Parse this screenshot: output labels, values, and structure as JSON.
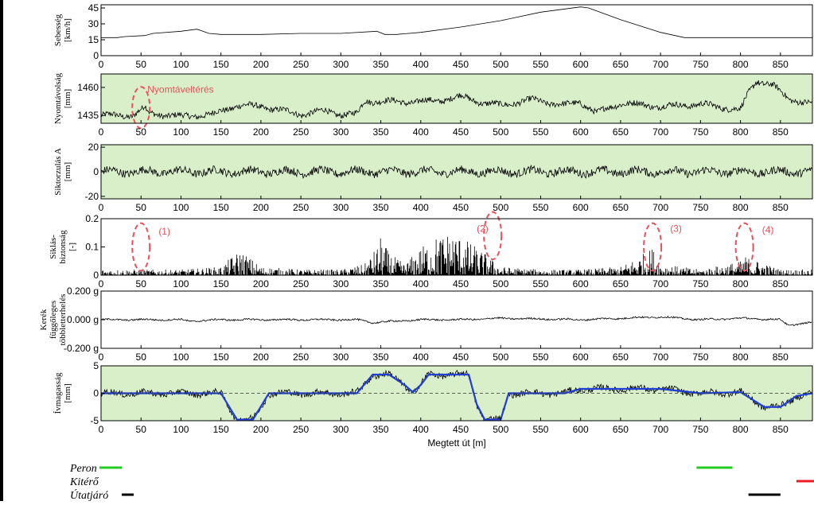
{
  "colors": {
    "panel_green": "#d9efc9",
    "trace": "#000000",
    "fit": "#1f3fd6",
    "annotation": "#e8505b",
    "peron": "#22cc22",
    "kitero": "#ee1c24",
    "utatjaro": "#000000"
  },
  "chart_data": {
    "type": "line",
    "xlabel": "Megtett út [m]",
    "xlim": [
      0,
      890
    ],
    "xticks": [
      0,
      50,
      100,
      150,
      200,
      250,
      300,
      350,
      400,
      450,
      500,
      550,
      600,
      650,
      700,
      750,
      800,
      850
    ],
    "panels": [
      {
        "id": "speed",
        "ylabel_lines": [
          "Sebesség",
          "[km/h]"
        ],
        "ylim": [
          0,
          48
        ],
        "yticks": [
          0,
          15,
          30,
          45
        ],
        "ytick_labels": [
          "0",
          "15",
          "30",
          "45"
        ],
        "background": "white",
        "trace": "smooth",
        "series": [
          {
            "x": [
              0,
              20,
              30,
              55,
              65,
              100,
              120,
              135,
              150,
              200,
              250,
              300,
              345,
              355,
              370,
              400,
              450,
              500,
              550,
              600,
              610,
              650,
              700,
              730,
              750,
              800,
              850,
              890
            ],
            "y": [
              17,
              17,
              18,
              19,
              21,
              23,
              25,
              21,
              20,
              20,
              21,
              21,
              23,
              20,
              20,
              22,
              27,
              33,
              41,
              46,
              45,
              34,
              22,
              17,
              17,
              17,
              17,
              17
            ]
          }
        ]
      },
      {
        "id": "gauge",
        "ylabel_lines": [
          "Nyomtávolság",
          "[mm]"
        ],
        "ylim": [
          1428,
          1472
        ],
        "yticks": [
          1435,
          1460
        ],
        "ytick_labels": [
          "1435",
          "1460"
        ],
        "background": "green",
        "trace": "noisy",
        "series": [
          {
            "x": [
              0,
              40,
              55,
              60,
              100,
              140,
              170,
              200,
              250,
              280,
              300,
              320,
              330,
              380,
              420,
              450,
              480,
              500,
              540,
              580,
              600,
              620,
              650,
              700,
              750,
              780,
              800,
              810,
              820,
              840,
              860,
              890
            ],
            "y": [
              1435,
              1435,
              1442,
              1437,
              1434,
              1436,
              1444,
              1443,
              1436,
              1439,
              1436,
              1436,
              1448,
              1447,
              1448,
              1452,
              1446,
              1444,
              1449,
              1444,
              1447,
              1437,
              1446,
              1443,
              1445,
              1442,
              1440,
              1455,
              1466,
              1462,
              1450,
              1445
            ]
          }
        ],
        "annotations": [
          {
            "type": "ellipse",
            "x": 50,
            "y": 1442
          },
          {
            "type": "text",
            "x": 58,
            "y": 1458,
            "text": "Nyomtáveltérés"
          }
        ]
      },
      {
        "id": "twist",
        "ylabel_lines": [
          "Siktorzulás A",
          "[mm]"
        ],
        "ylim": [
          -22,
          22
        ],
        "yticks": [
          -20,
          0,
          20
        ],
        "ytick_labels": [
          "-20",
          "0",
          "20"
        ],
        "background": "green",
        "trace": "noisy",
        "series": [
          {
            "x": [
              0,
              100,
              200,
              300,
              400,
              500,
              600,
              690,
              700,
              710,
              800,
              890
            ],
            "y": [
              0,
              0,
              0,
              0,
              0,
              0,
              0,
              0,
              0,
              0,
              0,
              0
            ]
          }
        ]
      },
      {
        "id": "safety",
        "ylabel_lines": [
          "Siklás-",
          "biztonság",
          "[-]"
        ],
        "ylim": [
          0,
          0.2
        ],
        "yticks": [
          0,
          0.1,
          0.2
        ],
        "ytick_labels": [
          "0",
          "0.1",
          "0.2"
        ],
        "background": "white",
        "trace": "spiky",
        "series": [
          {
            "x": [
              0,
              50,
              100,
              150,
              165,
              175,
              200,
              250,
              300,
              330,
              345,
              350,
              360,
              380,
              400,
              420,
              440,
              460,
              480,
              500,
              550,
              600,
              650,
              680,
              690,
              700,
              750,
              800,
              805,
              850,
              890
            ],
            "y": [
              0.02,
              0.02,
              0.02,
              0.03,
              0.07,
              0.09,
              0.03,
              0.02,
              0.02,
              0.04,
              0.1,
              0.14,
              0.08,
              0.04,
              0.1,
              0.14,
              0.16,
              0.12,
              0.08,
              0.03,
              0.02,
              0.02,
              0.03,
              0.08,
              0.1,
              0.04,
              0.02,
              0.05,
              0.07,
              0.02,
              0.02
            ]
          }
        ],
        "annotations": [
          {
            "type": "ellipse",
            "x": 50,
            "y": 0.1
          },
          {
            "type": "text",
            "x": 72,
            "y": 0.155,
            "text": "(1)"
          },
          {
            "type": "ellipse",
            "x": 490,
            "y": 0.14
          },
          {
            "type": "text",
            "x": 470,
            "y": 0.165,
            "text": "(2)"
          },
          {
            "type": "ellipse",
            "x": 690,
            "y": 0.1
          },
          {
            "type": "text",
            "x": 712,
            "y": 0.165,
            "text": "(3)"
          },
          {
            "type": "ellipse",
            "x": 805,
            "y": 0.1
          },
          {
            "type": "text",
            "x": 827,
            "y": 0.16,
            "text": "(4)"
          }
        ]
      },
      {
        "id": "load",
        "ylabel_lines": [
          "Kerék",
          "függőleges",
          "többletterhelés"
        ],
        "ylim": [
          -0.2,
          0.2
        ],
        "yticks": [
          -0.2,
          0,
          0.2
        ],
        "ytick_labels": [
          "-0.200 g",
          "0.000 g",
          "0.200 g"
        ],
        "background": "white",
        "trace": "mild",
        "series": [
          {
            "x": [
              0,
              50,
              100,
              110,
              150,
              200,
              300,
              320,
              340,
              400,
              450,
              500,
              600,
              700,
              750,
              800,
              850,
              860,
              870,
              890
            ],
            "y": [
              0,
              0,
              0,
              -0.01,
              0,
              0,
              0,
              0,
              -0.02,
              0,
              0,
              0.01,
              0,
              0.02,
              0,
              0.01,
              0,
              -0.04,
              -0.03,
              -0.02
            ]
          }
        ]
      },
      {
        "id": "cant",
        "ylabel_lines": [
          "Ívmagasság",
          "[mm]"
        ],
        "ylim": [
          -5,
          5
        ],
        "yticks": [
          -5,
          0,
          5
        ],
        "ytick_labels": [
          "-5",
          "0",
          "5"
        ],
        "background": "green",
        "trace": "noisy",
        "series": [
          {
            "x": [
              0,
              150,
              170,
              190,
              210,
              320,
              340,
              360,
              380,
              390,
              400,
              410,
              420,
              460,
              470,
              480,
              500,
              510,
              580,
              600,
              700,
              750,
              800,
              830,
              840,
              850,
              870,
              890
            ],
            "y": [
              0,
              0,
              -4.8,
              -4.8,
              0,
              0,
              3.4,
              3.4,
              1.5,
              0.2,
              1.5,
              3.4,
              3.4,
              3.4,
              -2,
              -4.8,
              -4.8,
              0,
              0,
              0.8,
              0.8,
              0,
              0.2,
              -2.5,
              -2.5,
              -2.5,
              -0.5,
              0
            ]
          },
          {
            "x": [
              0,
              150,
              170,
              190,
              210,
              320,
              340,
              360,
              380,
              390,
              400,
              410,
              420,
              460,
              470,
              480,
              500,
              510,
              580,
              600,
              700,
              750,
              800,
              830,
              840,
              850,
              870,
              890
            ],
            "y": [
              0,
              0,
              -4.8,
              -4.8,
              0,
              0,
              3.4,
              3.4,
              1.5,
              0.2,
              1.5,
              3.4,
              3.4,
              3.4,
              -2,
              -4.8,
              -4.8,
              0,
              0,
              0.8,
              0.8,
              0,
              0.2,
              -2.5,
              -2.5,
              -2.5,
              -0.5,
              0
            ]
          }
        ]
      }
    ],
    "track_features": [
      {
        "name": "Peron",
        "segments": [
          [
            745,
            790
          ]
        ]
      },
      {
        "name": "Kitérő",
        "segments": [
          [
            870,
            900
          ]
        ]
      },
      {
        "name": "Útatjáró",
        "segments": [
          [
            30,
            40
          ],
          [
            810,
            850
          ]
        ]
      }
    ]
  }
}
